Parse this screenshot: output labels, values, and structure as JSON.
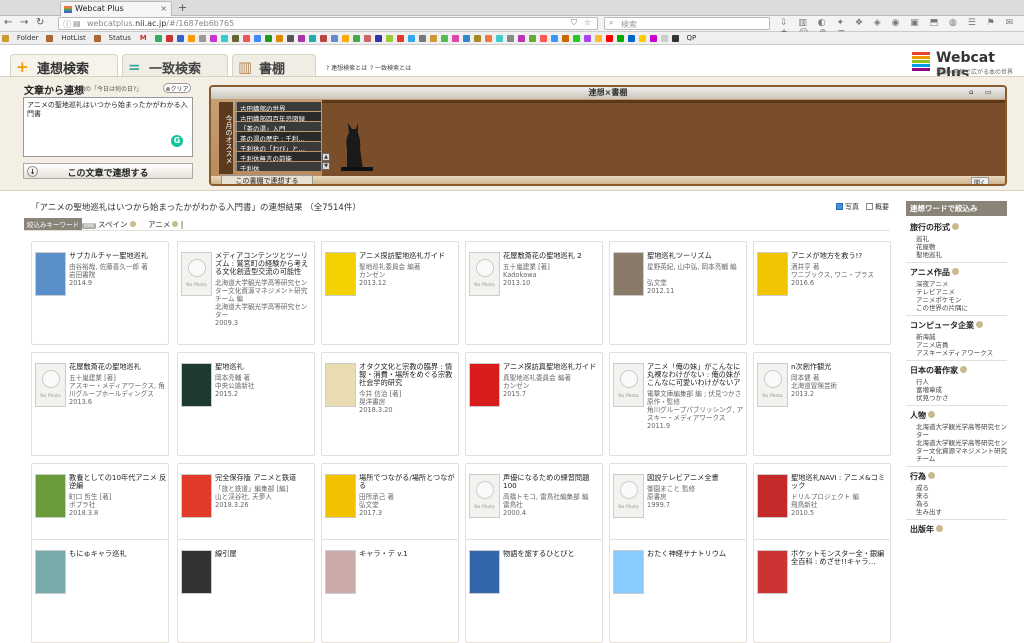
{
  "browser": {
    "tab_title": "Webcat Plus",
    "url_prefix": "webcatplus.",
    "url_domain": "nii.ac.jp",
    "url_path": "/#/1687eb6b765",
    "search_placeholder": "検索",
    "bookmarks": [
      "Folder",
      "HotList",
      "Status",
      "M",
      "QP"
    ]
  },
  "header": {
    "tabs": [
      "連想検索",
      "一致検索",
      "書棚"
    ],
    "help1": "連想検索とは",
    "help2": "一致検索とは",
    "logo_title": "Webcat Plus",
    "logo_sub": "連想×書棚で広がる本の世界"
  },
  "search": {
    "label": "文章から連想",
    "sub": "他の「今日は何の日?」",
    "clear": "クリア",
    "text": "アニメの聖地巡礼はいつから始まったかがわかる入門書",
    "submit": "この文章で連想する"
  },
  "shelf": {
    "title": "連想×書棚",
    "osusume": "今月のオススメ",
    "books": [
      "古田織部の世界",
      "古田織部四百年忌図録",
      "「茶の湯」入門",
      "茶の湯の歴史 : 千利…",
      "千利休の「わび」と…",
      "千利休無言の前衛",
      "千利休"
    ],
    "to_this": "この書棚で連想する",
    "open": "開く"
  },
  "results": {
    "title": "「アニメの聖地巡礼はいつから始まったかがわかる入門書」の連想結果 （全7514件）",
    "opt_photo": "写真",
    "opt_summary": "概要",
    "kw_label": "絞込みキーワード",
    "kw_tag": "削除",
    "kw1": "スペイン",
    "kw2": "アニメ",
    "no_photo": "No Photo"
  },
  "cards": [
    {
      "title": "サブカルチャー聖地巡礼",
      "meta": [
        "由谷裕哉, 佐藤喜久一郎 著",
        "岩田書院",
        "2014.9"
      ],
      "cover": "img",
      "color": "#5a8fc9"
    },
    {
      "title": "メディアコンテンツとツーリズム : 鷲宮町の経験から考える文化創造型交流の可能性",
      "meta": [
        "北海道大学観光学高等研究センター文化資源マネジメント研究チーム 編",
        "北海道大学観光学高等研究センター",
        "2009.3"
      ],
      "cover": "nophoto"
    },
    {
      "title": "アニメ探訪聖地巡礼ガイド",
      "meta": [
        "聖地巡礼委員会 編著",
        "カンゼン",
        "2013.12"
      ],
      "cover": "img",
      "color": "#f2d200"
    },
    {
      "title": "花屋敷斎花の聖地巡礼 2",
      "meta": [
        "五十嵐建業 [著]",
        "Kadokawa",
        "2013.10"
      ],
      "cover": "nophoto"
    },
    {
      "title": "聖地巡礼ツーリズム",
      "meta": [
        "星野英紀, 山中弘, 岡本亮輔 編",
        "弘文堂",
        "2012.11"
      ],
      "cover": "img",
      "color": "#8a7a6a"
    },
    {
      "title": "アニメが地方を救う!?",
      "meta": [
        "酒井亨 著",
        "ワニブックス, ワニ・プラス",
        "2016.6"
      ],
      "cover": "img",
      "color": "#f0c400"
    },
    {
      "title": "花屋敷斎花の聖地巡礼",
      "meta": [
        "五十嵐建業 [著]",
        "アスキー・メディアワークス, 角川グループホールディングス",
        "2013.6"
      ],
      "cover": "nophoto"
    },
    {
      "title": "聖地巡礼",
      "meta": [
        "岡本亮輔 著",
        "中央公論新社",
        "2015.2"
      ],
      "cover": "img",
      "color": "#1e3a2e"
    },
    {
      "title": "オタク文化と宗教の臨界 : 情報・消費・場所をめぐる宗教社会学的研究",
      "meta": [
        "今井 信治 [著]",
        "晃洋書房",
        "2018.3.20"
      ],
      "cover": "img",
      "color": "#e8dcb0"
    },
    {
      "title": "アニメ探訪真聖地巡礼ガイド",
      "meta": [
        "真聖地巡礼委員会 編著",
        "カンゼン",
        "2015.7"
      ],
      "cover": "img",
      "color": "#d81c1c"
    },
    {
      "title": "アニメ「俺の妹」がこんなに丸裸なわけがない : 俺の妹がこんなに可愛いわけがないアニメ公式ガイドブック",
      "meta": [
        "電撃文庫編集部 編 ; 伏見つかさ 原作・監修",
        "角川グループパブリッシング, アスキー・メディアワークス",
        "2011.9"
      ],
      "cover": "nophoto"
    },
    {
      "title": "n次創作観光",
      "meta": [
        "岡本健 著",
        "北海道冒険芸術",
        "2013.2"
      ],
      "cover": "nophoto"
    },
    {
      "title": "教養としての10年代アニメ 反逆編",
      "meta": [
        "町口 哲生 [著]",
        "ポプラ社",
        "2018.3.8"
      ],
      "cover": "img",
      "color": "#6a9a3a"
    },
    {
      "title": "完全保存版 アニメと鉄道",
      "meta": [
        "「旅と鉄道」編集部 [編]",
        "山と渓谷社, 天夢人",
        "2018.3.26"
      ],
      "cover": "img",
      "color": "#e03a2a"
    },
    {
      "title": "場所でつながる/場所とつながる",
      "meta": [
        "田所承己 著",
        "弘文堂",
        "2017.3"
      ],
      "cover": "img",
      "color": "#f2c200"
    },
    {
      "title": "声優になるための練習問題100",
      "meta": [
        "高橋トモコ, 雷鳥社編集部 編",
        "雷鳥社",
        "2000.4"
      ],
      "cover": "nophoto"
    },
    {
      "title": "図説テレビアニメ全書",
      "meta": [
        "御園まこと 監修",
        "原書房",
        "1999.7"
      ],
      "cover": "nophoto"
    },
    {
      "title": "聖地巡礼NAVI : アニメ&コミック",
      "meta": [
        "ドリルプロジェクト 編",
        "飛鳥新社",
        "2010.5"
      ],
      "cover": "img",
      "color": "#c42a2a"
    },
    {
      "title": "もにゅキャラ巡礼",
      "meta": [],
      "cover": "img",
      "color": "#7aa"
    },
    {
      "title": "線引屋",
      "meta": [],
      "cover": "img",
      "color": "#333"
    },
    {
      "title": "キャラ・デ v.1",
      "meta": [],
      "cover": "img",
      "color": "#caa"
    },
    {
      "title": "物語を旅するひとびと",
      "meta": [],
      "cover": "img",
      "color": "#36a"
    },
    {
      "title": "おたく神経サナトリウム",
      "meta": [],
      "cover": "img",
      "color": "#8cf"
    },
    {
      "title": "ポケットモンスター全・銀編 全百科 : めざせ!!キャラ…",
      "meta": [],
      "cover": "img",
      "color": "#c33"
    }
  ],
  "sidebar": {
    "head": "連想ワードで絞込み",
    "cats": [
      {
        "name": "旅行の形式",
        "items": [
          "巡礼",
          "花屋敷",
          "聖地巡礼"
        ]
      },
      {
        "name": "アニメ作品",
        "items": [
          "深夜アニメ",
          "テレビアニメ",
          "アニメポケモン",
          "この世界の片隅に"
        ]
      },
      {
        "name": "コンピュータ企業",
        "items": [
          "新海誠",
          "アニメ店員",
          "アスキーメディアワークス"
        ]
      },
      {
        "name": "日本の著作家",
        "items": [
          "行人",
          "富増章成",
          "伏見つかさ"
        ]
      },
      {
        "name": "人物",
        "items": [
          "北海道大学観光学高等研究センター",
          "北海道大学観光学高等研究センター文化資源マネジメント研究チーム"
        ]
      },
      {
        "name": "行為",
        "items": [
          "成る",
          "来る",
          "為る",
          "生み出す"
        ]
      },
      {
        "name": "出版年",
        "items": []
      }
    ]
  },
  "colors": {
    "accent": "#8a8478",
    "shelf": "#8b5a2b",
    "logo_bars": [
      "#e8432e",
      "#f39800",
      "#8fc31f",
      "#00a0e9",
      "#920783"
    ]
  }
}
